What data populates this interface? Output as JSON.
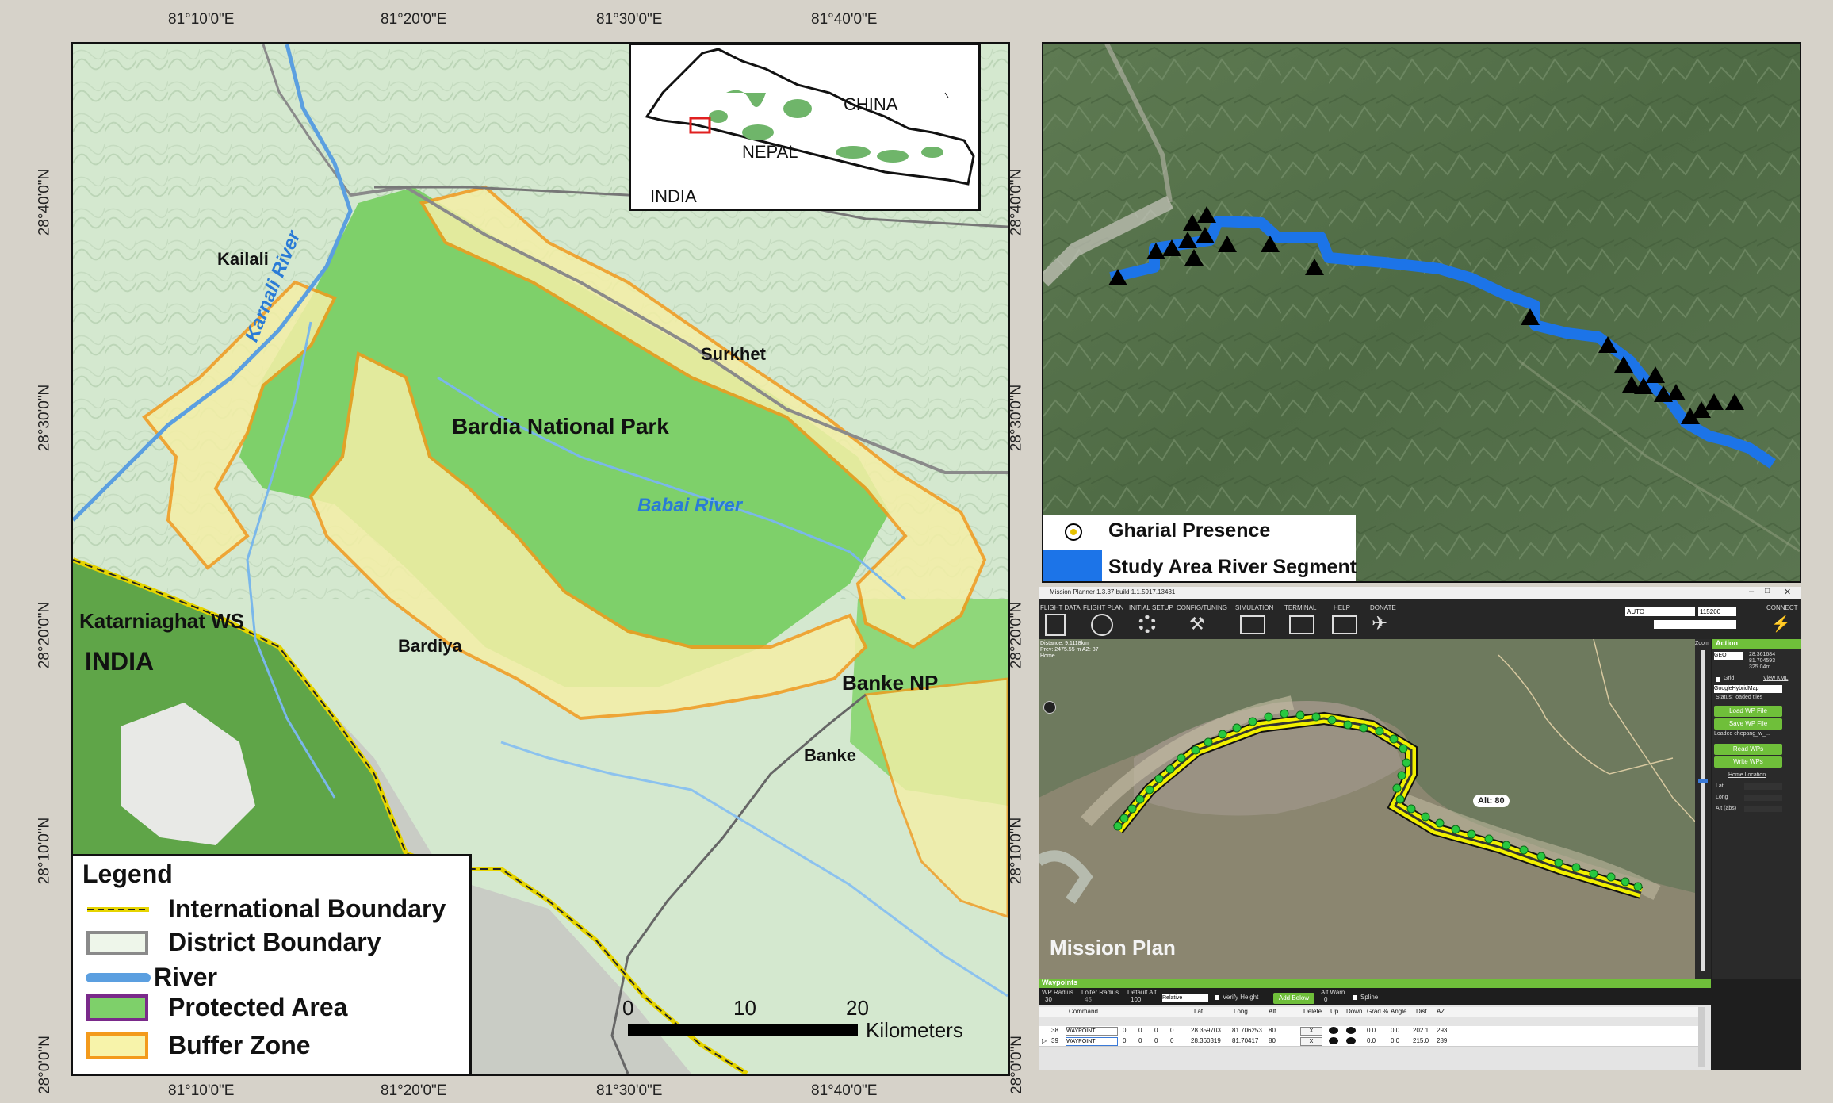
{
  "top_coords": [
    "81°10'0\"E",
    "81°20'0\"E",
    "81°30'0\"E",
    "81°40'0\"E"
  ],
  "bottom_coords": [
    "81°10'0\"E",
    "81°20'0\"E",
    "81°30'0\"E",
    "81°40'0\"E"
  ],
  "left_coords": [
    "28°40'0\"N",
    "28°30'0\"N",
    "28°20'0\"N",
    "28°10'0\"N",
    "28°0'0\"N"
  ],
  "right_coords": [
    "28°40'0\"N",
    "28°30'0\"N",
    "28°20'0\"N",
    "28°10'0\"N",
    "28°0'0\"N"
  ],
  "main_map": {
    "labels": {
      "kailali": "Kailali",
      "surkhet": "Surkhet",
      "bardia_np": "Bardia National Park",
      "bardiya": "Bardiya",
      "katarniaghat": "Katarniaghat WS",
      "india": "INDIA",
      "banke_np": "Banke NP",
      "banke": "Banke"
    },
    "rivers": {
      "karnali": "Karnali River",
      "babai": "Babai River"
    },
    "scale": {
      "ticks": [
        "0",
        "10",
        "20"
      ],
      "unit": "Kilometers"
    }
  },
  "inset": {
    "china": "CHINA",
    "nepal": "NEPAL",
    "india": "INDIA"
  },
  "legend": {
    "title": "Legend",
    "items": [
      "International Boundary",
      "District Boundary",
      "River",
      "Protected Area",
      "Buffer Zone"
    ]
  },
  "satellite": {
    "legend": [
      "Gharial Presence",
      "Study Area River Segment"
    ]
  },
  "mission_planner": {
    "title": "Mission Planner 1.3.37 build 1.1.5917.13431",
    "menu": [
      "FLIGHT DATA",
      "FLIGHT PLAN",
      "INITIAL SETUP",
      "CONFIG/TUNING",
      "SIMULATION",
      "TERMINAL",
      "HELP",
      "DONATE"
    ],
    "connect": "CONNECT",
    "mode": "AUTO",
    "baud": "115200",
    "distance": [
      "Distance: 9.1118km",
      "Prev: 2475.55 m AZ: 87",
      "Home"
    ],
    "zoom_label": "Zoom",
    "action_title": "Action",
    "coords": [
      "GEO",
      "28.361684",
      "81.704593",
      "325.04m"
    ],
    "grid": "Grid",
    "view_kml": "View KML",
    "map_type": "GoogleHybridMap",
    "status": "Status: loaded tiles",
    "buttons": [
      "Load WP File",
      "Save WP File",
      "Read WPs",
      "Write WPs"
    ],
    "loaded": "Loaded chepang_w_...",
    "home_location": "Home Location",
    "home_fields": [
      "Lat",
      "Long",
      "Alt (abs)"
    ],
    "alt_badge": "Alt: 80",
    "overlay_label": "Mission Plan",
    "waypoints_title": "Waypoints",
    "wp_options": [
      "WP Radius",
      "Loiter Radius",
      "Default Alt",
      "Relative",
      "Verify Height",
      "Add Below",
      "Alt Warn",
      "Spline"
    ],
    "wp_values": [
      "30",
      "45",
      "100",
      "0"
    ],
    "columns": [
      "Command",
      "Lat",
      "Long",
      "Alt",
      "Delete",
      "Up",
      "Down",
      "Grad %",
      "Angle",
      "Dist",
      "AZ"
    ],
    "rows": [
      {
        "num": "38",
        "cmd": "WAYPOINT",
        "z1": "0",
        "z2": "0",
        "z3": "0",
        "z4": "0",
        "lat": "28.359703",
        "long": "81.706253",
        "alt": "80",
        "del": "X",
        "grad": "0.0",
        "angle": "0.0",
        "dist": "202.1",
        "az": "293"
      },
      {
        "num": "39",
        "cmd": "WAYPOINT",
        "z1": "0",
        "z2": "0",
        "z3": "0",
        "z4": "0",
        "lat": "28.360319",
        "long": "81.70417",
        "alt": "80",
        "del": "X",
        "grad": "0.0",
        "angle": "0.0",
        "dist": "215.0",
        "az": "289"
      }
    ]
  }
}
